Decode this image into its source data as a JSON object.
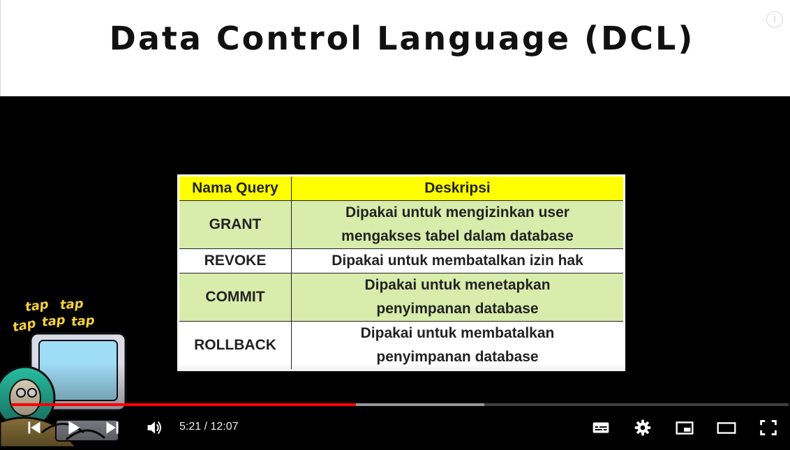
{
  "slide": {
    "title": "Data Control Language (DCL)"
  },
  "table": {
    "headers": [
      "Nama Query",
      "Deskripsi"
    ],
    "rows": [
      {
        "query": "GRANT",
        "desc_line1": "Dipakai untuk mengizinkan user",
        "desc_line2": "mengakses tabel dalam database"
      },
      {
        "query": "REVOKE",
        "desc_line1": "Dipakai untuk membatalkan izin hak",
        "desc_line2": ""
      },
      {
        "query": "COMMIT",
        "desc_line1": "Dipakai untuk menetapkan",
        "desc_line2": "penyimpanan database"
      },
      {
        "query": "ROLLBACK",
        "desc_line1": "Dipakai untuk membatalkan",
        "desc_line2": "penyimpanan database"
      }
    ],
    "colors": {
      "header_bg": "#ffff00",
      "green_row": "#d8ecab",
      "white_row": "#ffffff"
    }
  },
  "mascot": {
    "tap_words": [
      "tap",
      "tap",
      "tap",
      "tap",
      "tap"
    ]
  },
  "player": {
    "current_time": "5:21",
    "separator": " / ",
    "duration": "12:07",
    "played_fraction": 0.443,
    "buffered_fraction": 0.609,
    "accent_color": "#ff0000",
    "icons": {
      "previous": "skip-previous-icon",
      "play": "play-icon",
      "next": "skip-next-icon",
      "volume": "volume-icon",
      "subtitles": "subtitles-icon",
      "settings": "gear-icon",
      "miniplayer": "miniplayer-icon",
      "theater": "theater-mode-icon",
      "fullscreen": "fullscreen-icon",
      "info": "info-icon"
    }
  }
}
